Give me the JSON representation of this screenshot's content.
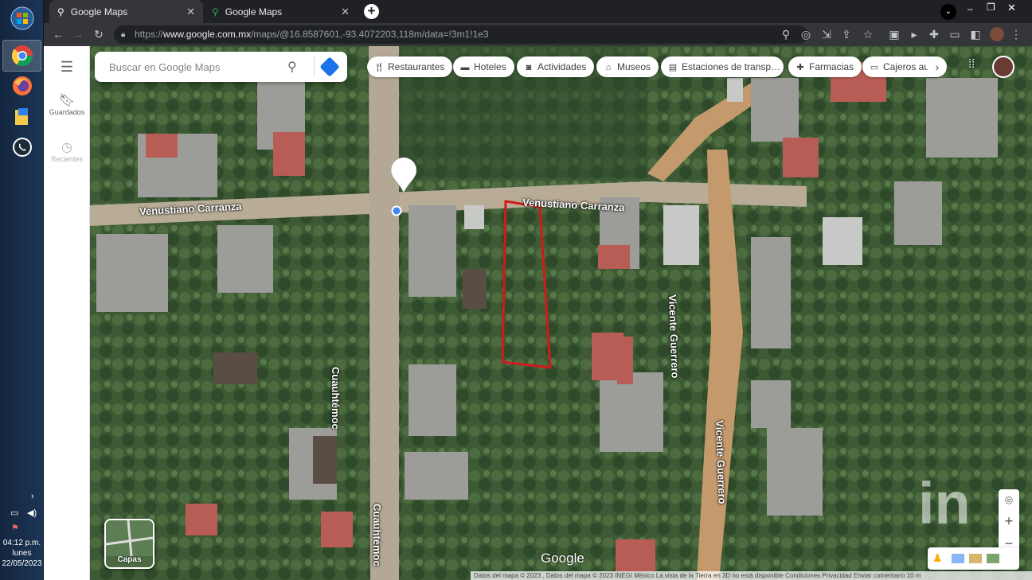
{
  "browser": {
    "tabs": [
      {
        "title": "Google Maps",
        "active": true
      },
      {
        "title": "Google Maps",
        "active": false
      }
    ],
    "url_prefix": "https://",
    "url_host": "www.google.com.mx",
    "url_path": "/maps/@16.8587601,-93.4072203,118m/data=!3m1!1e3"
  },
  "taskbar": {
    "time": "04:12 p.m.",
    "day": "lunes",
    "date": "22/05/2023"
  },
  "maps": {
    "search": {
      "placeholder": "Buscar en Google Maps"
    },
    "sidebar": {
      "saved_label": "Guardados",
      "recent_label": "Recientes"
    },
    "chips": [
      {
        "label": "Restaurantes",
        "icon": "fork-knife-icon"
      },
      {
        "label": "Hoteles",
        "icon": "bed-icon"
      },
      {
        "label": "Actividades",
        "icon": "camera-icon"
      },
      {
        "label": "Museos",
        "icon": "museum-icon"
      },
      {
        "label": "Estaciones de transp…",
        "icon": "bus-icon"
      },
      {
        "label": "Farmacias",
        "icon": "pharmacy-icon"
      },
      {
        "label": "Cajeros au",
        "icon": "atm-icon"
      }
    ],
    "streets": {
      "carranza_left": "Venustiano Carranza",
      "carranza_right": "Venustiano Carranza",
      "cuauhtemoc_top": "Cuauhtémoc",
      "cuauhtemoc_bottom": "Cuauhtémoc",
      "guerrero_top": "Vicente Guerrero",
      "guerrero_bottom": "Vicente Guerrero"
    },
    "layers_label": "Capas",
    "logo": "Google",
    "footer": "Datos del mapa © 2023 , Datos del mapa © 2023 INEGI    México    La vista de la Tierra en 3D no está disponible    Condiciones    Privacidad    Enviar comentario    10 m",
    "colors": {
      "outline": "#d11a1a",
      "vegetation": "#3f5a37"
    }
  }
}
